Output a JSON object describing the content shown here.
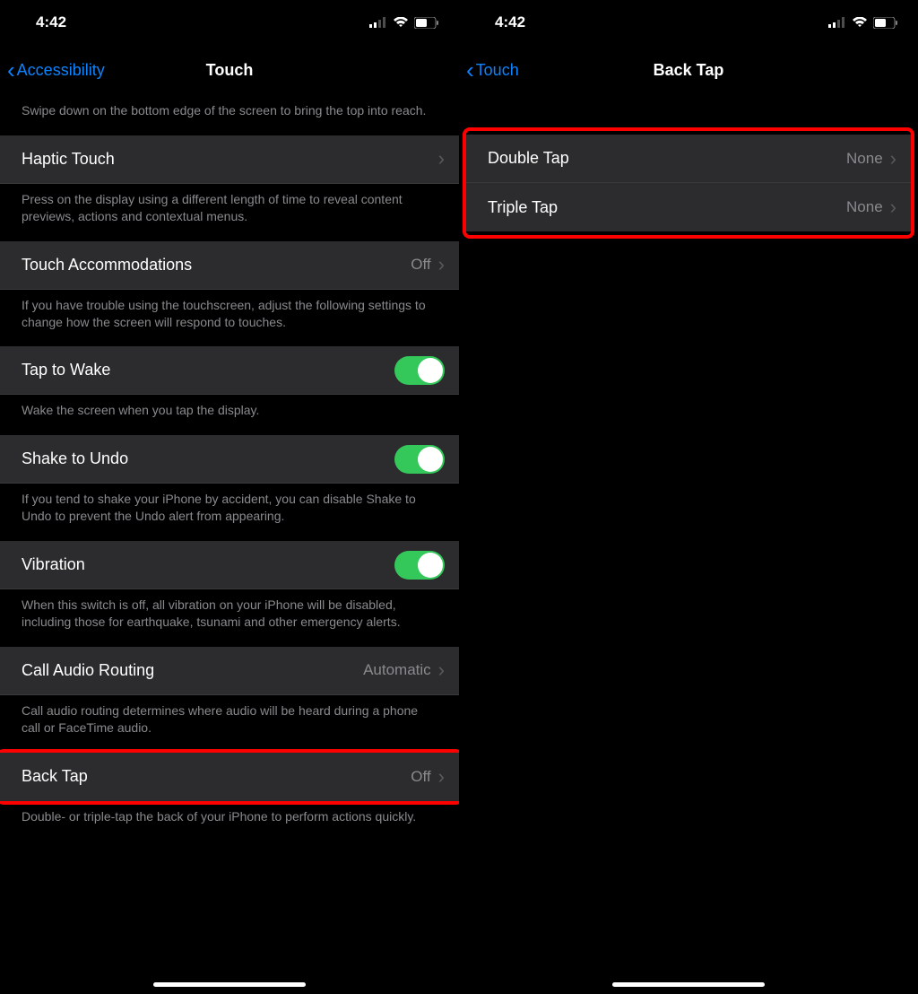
{
  "left": {
    "status_time": "4:42",
    "nav_back": "Accessibility",
    "nav_title": "Touch",
    "reachability_footer": "Swipe down on the bottom edge of the screen to bring the top into reach.",
    "rows": {
      "haptic_touch": {
        "label": "Haptic Touch",
        "footer": "Press on the display using a different length of time to reveal content previews, actions and contextual menus."
      },
      "touch_accommodations": {
        "label": "Touch Accommodations",
        "value": "Off",
        "footer": "If you have trouble using the touchscreen, adjust the following settings to change how the screen will respond to touches."
      },
      "tap_to_wake": {
        "label": "Tap to Wake",
        "footer": "Wake the screen when you tap the display."
      },
      "shake_to_undo": {
        "label": "Shake to Undo",
        "footer": "If you tend to shake your iPhone by accident, you can disable Shake to Undo to prevent the Undo alert from appearing."
      },
      "vibration": {
        "label": "Vibration",
        "footer": "When this switch is off, all vibration on your iPhone will be disabled, including those for earthquake, tsunami and other emergency alerts."
      },
      "call_audio": {
        "label": "Call Audio Routing",
        "value": "Automatic",
        "footer": "Call audio routing determines where audio will be heard during a phone call or FaceTime audio."
      },
      "back_tap": {
        "label": "Back Tap",
        "value": "Off",
        "footer": "Double- or triple-tap the back of your iPhone to perform actions quickly."
      }
    }
  },
  "right": {
    "status_time": "4:42",
    "nav_back": "Touch",
    "nav_title": "Back Tap",
    "rows": {
      "double_tap": {
        "label": "Double Tap",
        "value": "None"
      },
      "triple_tap": {
        "label": "Triple Tap",
        "value": "None"
      }
    }
  }
}
